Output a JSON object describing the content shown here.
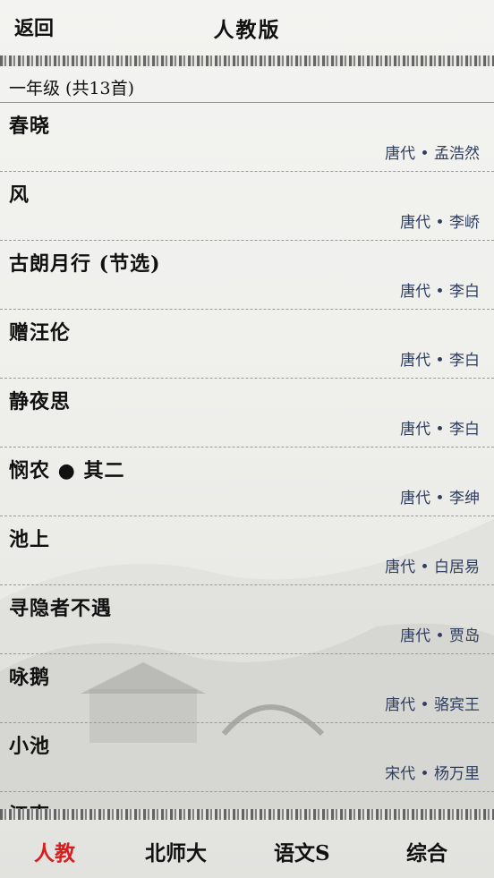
{
  "header": {
    "back_label": "返回",
    "title": "人教版"
  },
  "section": {
    "title": "一年级 (共13首)"
  },
  "poems": [
    {
      "name": "春晓",
      "author": "唐代 • 孟浩然"
    },
    {
      "name": "风",
      "author": "唐代 • 李峤"
    },
    {
      "name": "古朗月行 (节选)",
      "author": "唐代 • 李白"
    },
    {
      "name": "赠汪伦",
      "author": "唐代 • 李白"
    },
    {
      "name": "静夜思",
      "author": "唐代 • 李白"
    },
    {
      "name": "悯农 ● 其二",
      "author": "唐代 • 李绅"
    },
    {
      "name": "池上",
      "author": "唐代 • 白居易"
    },
    {
      "name": "寻隐者不遇",
      "author": "唐代 • 贾岛"
    },
    {
      "name": "咏鹅",
      "author": "唐代 • 骆宾王"
    },
    {
      "name": "小池",
      "author": "宋代 • 杨万里"
    },
    {
      "name": "江南",
      "author": ""
    }
  ],
  "tabs": [
    {
      "label": "人教",
      "active": true
    },
    {
      "label": "北师大",
      "active": false
    },
    {
      "label": "语文S",
      "active": false
    },
    {
      "label": "综合",
      "active": false
    }
  ],
  "colors": {
    "active_tab": "#d81e1e",
    "author_text": "#2f3e5e"
  }
}
